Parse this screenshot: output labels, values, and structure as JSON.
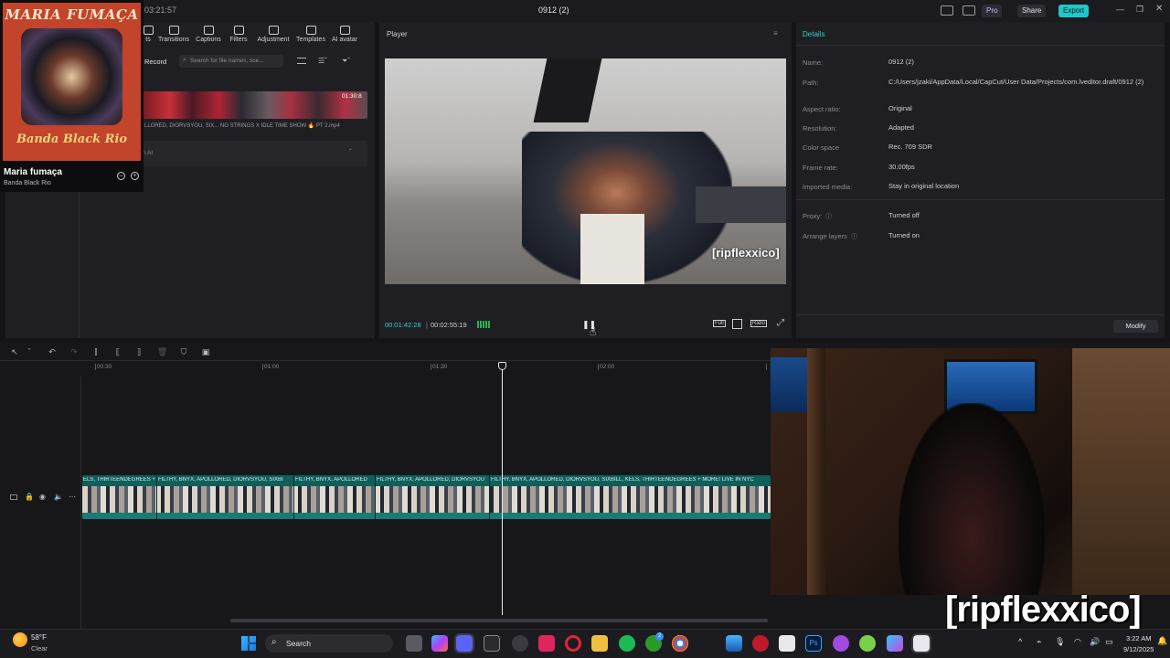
{
  "titlebar": {
    "time": "03:21:57",
    "project": "0912 (2)",
    "pro": "Pro",
    "share": "Share",
    "export": "Export"
  },
  "toolbar": {
    "items": [
      "ts",
      "Transitions",
      "Captions",
      "Filters",
      "Adjustment",
      "Templates",
      "AI avatar"
    ]
  },
  "media": {
    "record": "Record",
    "search_placeholder": "Search for file names, sce...",
    "clip_duration": "01:30:8",
    "clip_name": "LLORED, DIORVSYOU, SIX... NO STRINGS X IDLE TIME SHOW 🔥 PT 2.mp4",
    "ai_row": "h AI"
  },
  "music": {
    "album_title": "MARIA FUMAÇA",
    "album_artist": "Banda Black Rio",
    "track": "Maria fumaça",
    "artist": "Banda Black Rio"
  },
  "player": {
    "title": "Player",
    "watermark": "[ripflexxico]",
    "current_time": "00:01:42:28",
    "total_time": "00:02:55:19",
    "ratio": "Ratio",
    "full": "Full"
  },
  "details": {
    "title": "Details",
    "rows": [
      {
        "label": "Name:",
        "value": "0912 (2)"
      },
      {
        "label": "Path:",
        "value": "C:/Users/jzaki/AppData/Local/CapCut/User Data/Projects/com.lveditor.draft/0912 (2)"
      },
      {
        "label": "Aspect ratio:",
        "value": "Original"
      },
      {
        "label": "Resolution:",
        "value": "Adapted"
      },
      {
        "label": "Color space",
        "value": "Rec. 709 SDR"
      },
      {
        "label": "Frame rate:",
        "value": "30.00fps"
      },
      {
        "label": "Imported media:",
        "value": "Stay in original location"
      },
      {
        "label": "Proxy:",
        "value": "Turned off"
      },
      {
        "label": "Arrange layers",
        "value": "Turned on"
      }
    ],
    "modify": "Modify"
  },
  "timeline": {
    "ticks": [
      "00:30",
      "01:00",
      "01:30",
      "02:00"
    ],
    "clip_labels": [
      "ELS, THIRTEENDEGREES +",
      "FILTHY, BNYX, APOLLORED, DIORVSYOU, SIXBI",
      "FILTHY, BNYX, APOLLORED",
      "FILTHY, BNYX, APOLLORED, DIORVSYOU",
      "FILTHY, BNYX, APOLLORED, DIORVSYOU, SIXBILL, KELS, THIRTEENDEGREES + MORE! LIVE IN NYC"
    ]
  },
  "overlay": {
    "watermark": "[ripflexxico]"
  },
  "taskbar": {
    "weather_temp": "58°F",
    "weather_desc": "Clear",
    "search": "Search",
    "clock_time": "3:22 AM",
    "clock_date": "9/12/2025",
    "badge": "2"
  }
}
